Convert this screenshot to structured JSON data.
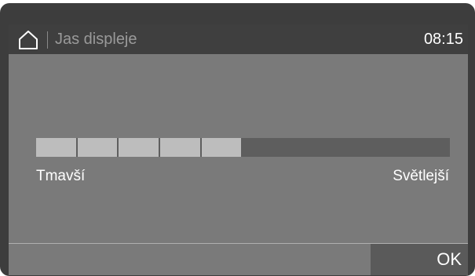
{
  "header": {
    "home_icon": "home-icon",
    "title": "Jas displeje",
    "time": "08:15"
  },
  "brightness": {
    "level": 5,
    "max_level": 10,
    "min_label": "Tmavší",
    "max_label": "Světlejší"
  },
  "footer": {
    "ok_label": "OK"
  },
  "colors": {
    "header_bg": "#3f3f3f",
    "screen_bg": "#7a7a7a",
    "segment_on": "#bdbdbd",
    "segment_off": "#5e5e5e"
  }
}
